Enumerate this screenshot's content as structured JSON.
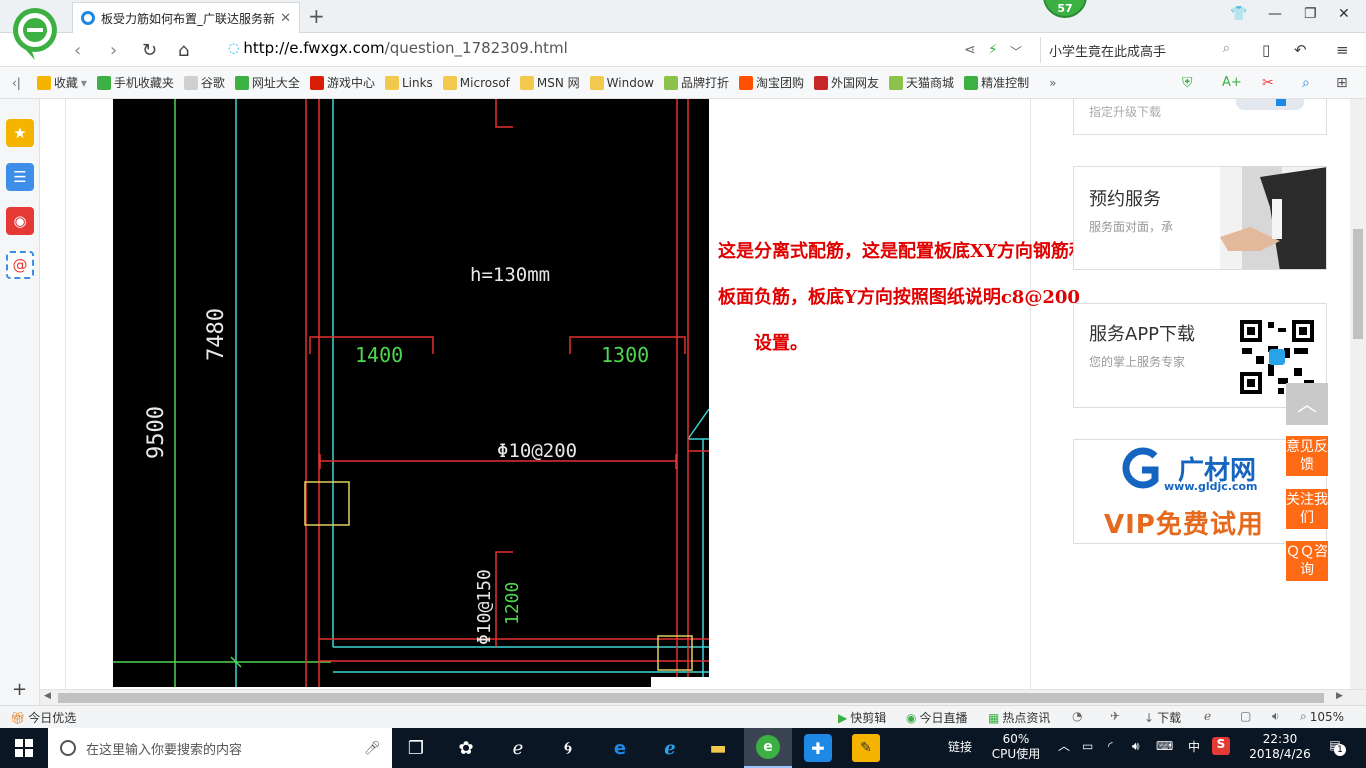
{
  "browser": {
    "tab_title": "板受力筋如何布置_广联达服务新",
    "badge_count": "57",
    "url_host": "http://e.fwxgx.com",
    "url_path": "/question_1782309.html",
    "search_text": "小学生竟在此成高手"
  },
  "bookmarks": [
    {
      "label": "收藏",
      "icon": "star-icon",
      "color": "#f5b400"
    },
    {
      "label": "手机收藏夹",
      "icon": "phone-icon",
      "color": "#3cb043"
    },
    {
      "label": "谷歌",
      "icon": "page-icon",
      "color": "#cfcfcf"
    },
    {
      "label": "网址大全",
      "icon": "nav-icon",
      "color": "#3cb043"
    },
    {
      "label": "游戏中心",
      "icon": "game-icon",
      "color": "#d81e06"
    },
    {
      "label": "Links",
      "icon": "folder-icon",
      "color": "#f2c94c"
    },
    {
      "label": "Microsof",
      "icon": "folder-icon",
      "color": "#f2c94c"
    },
    {
      "label": "MSN 网",
      "icon": "folder-icon",
      "color": "#f2c94c"
    },
    {
      "label": "Window",
      "icon": "folder-icon",
      "color": "#f2c94c"
    },
    {
      "label": "品牌打折",
      "icon": "leaf-icon",
      "color": "#8bc34a"
    },
    {
      "label": "淘宝团购",
      "icon": "taobao-icon",
      "color": "#ff5000"
    },
    {
      "label": "外国网友",
      "icon": "gate-icon",
      "color": "#c62828"
    },
    {
      "label": "天猫商城",
      "icon": "leaf-icon",
      "color": "#8bc34a"
    },
    {
      "label": "精准控制",
      "icon": "wechat-icon",
      "color": "#3cb043"
    }
  ],
  "cad": {
    "height_text": "h=130mm",
    "dim_7480": "7480",
    "dim_9500": "9500",
    "dim_1400": "1400",
    "dim_1300": "1300",
    "rebar_top": "Φ10@200",
    "rebar_side": "Φ10@150",
    "dim_1200": "1200"
  },
  "note": {
    "line1": "这是分离式配筋，这是配置板底XY方向钢筋和",
    "line2": "板面负筋，板底Y方向按照图纸说明c8@200",
    "line3": "设置。"
  },
  "right_cards": {
    "upgrade_text": "指定升级下载",
    "booking_title": "预约服务",
    "booking_sub": "服务面对面，承",
    "app_title": "服务APP下载",
    "app_sub": "您的掌上服务专家",
    "ad_brand": "广材网",
    "ad_url": "www.gldjc.com",
    "ad_slogan": "VIP免费试用"
  },
  "float_buttons": {
    "feedback": "意见反馈",
    "follow": "关注我们",
    "qq": "ＱＱ咨询"
  },
  "status_bar": {
    "today": "今日优选",
    "quick_cut": "快剪辑",
    "live": "今日直播",
    "hot": "热点资讯",
    "download": "下载",
    "zoom": "105%"
  },
  "taskbar": {
    "search_placeholder": "在这里输入你要搜索的内容",
    "link_label": "链接",
    "cpu_percent": "60%",
    "cpu_label": "CPU使用",
    "ime": "中",
    "time": "22:30",
    "date": "2018/4/26",
    "notif_count": "1"
  }
}
